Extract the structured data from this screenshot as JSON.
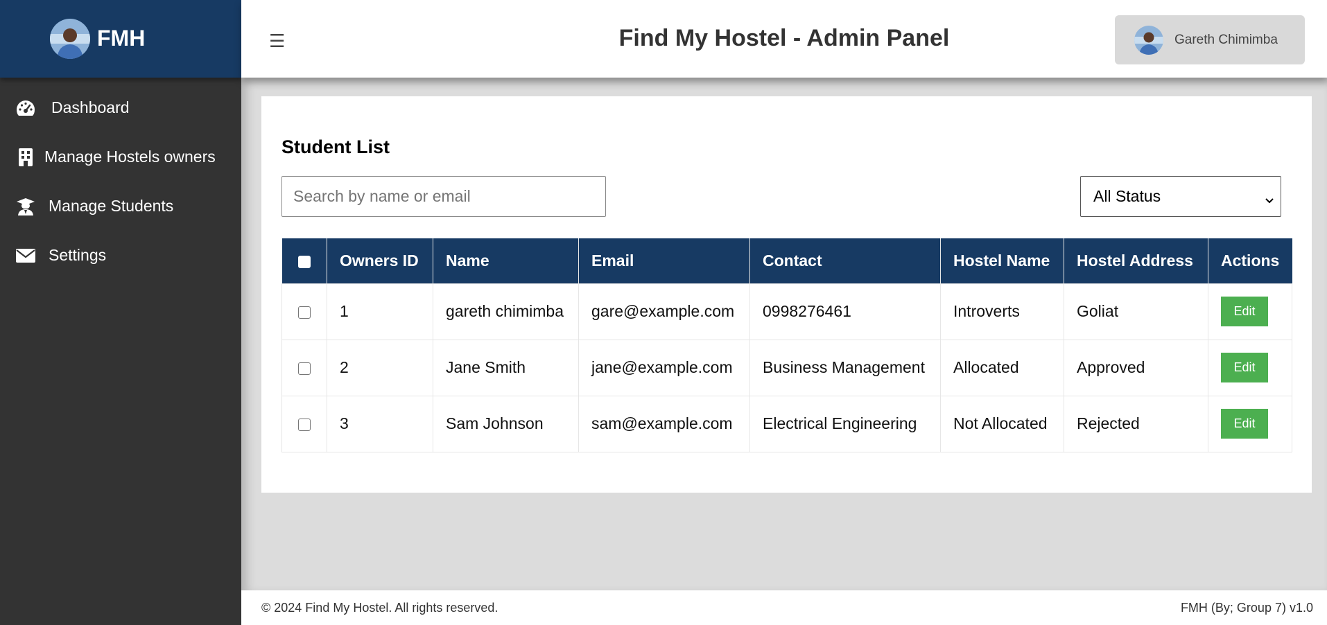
{
  "brand": {
    "short_name": "FMH"
  },
  "sidebar": {
    "items": [
      {
        "label": "Dashboard",
        "icon": "gauge-icon"
      },
      {
        "label": "Manage Hostels owners",
        "icon": "building-icon"
      },
      {
        "label": "Manage Students",
        "icon": "graduate-icon"
      },
      {
        "label": "Settings",
        "icon": "envelope-icon"
      }
    ]
  },
  "header": {
    "title": "Find My Hostel - Admin Panel",
    "user_name": "Gareth Chimimba",
    "menu_icon": "hamburger-icon"
  },
  "main": {
    "card_title": "Student List",
    "search": {
      "placeholder": "Search by name or email",
      "value": ""
    },
    "status_filter": {
      "selected": "All Status"
    },
    "table": {
      "columns": [
        "Owners ID",
        "Name",
        "Email",
        "Contact",
        "Hostel Name",
        "Hostel Address",
        "Actions"
      ],
      "rows": [
        {
          "id": "1",
          "name": "gareth chimimba",
          "email": "gare@example.com",
          "contact": "0998276461",
          "hostel_name": "Introverts",
          "hostel_address": "Goliat",
          "action": "Edit"
        },
        {
          "id": "2",
          "name": "Jane Smith",
          "email": "jane@example.com",
          "contact": "Business Management",
          "hostel_name": "Allocated",
          "hostel_address": "Approved",
          "action": "Edit"
        },
        {
          "id": "3",
          "name": "Sam Johnson",
          "email": "sam@example.com",
          "contact": "Electrical Engineering",
          "hostel_name": "Not Allocated",
          "hostel_address": "Rejected",
          "action": "Edit"
        }
      ]
    }
  },
  "footer": {
    "copyright": "© 2024 Find My Hostel. All rights reserved.",
    "version": "FMH (By; Group 7) v1.0"
  },
  "colors": {
    "sidebar_bg": "#333333",
    "brand_bg": "#173a63",
    "table_header_bg": "#173a63",
    "edit_button": "#4caf50",
    "page_bg": "#dcdcdc"
  }
}
